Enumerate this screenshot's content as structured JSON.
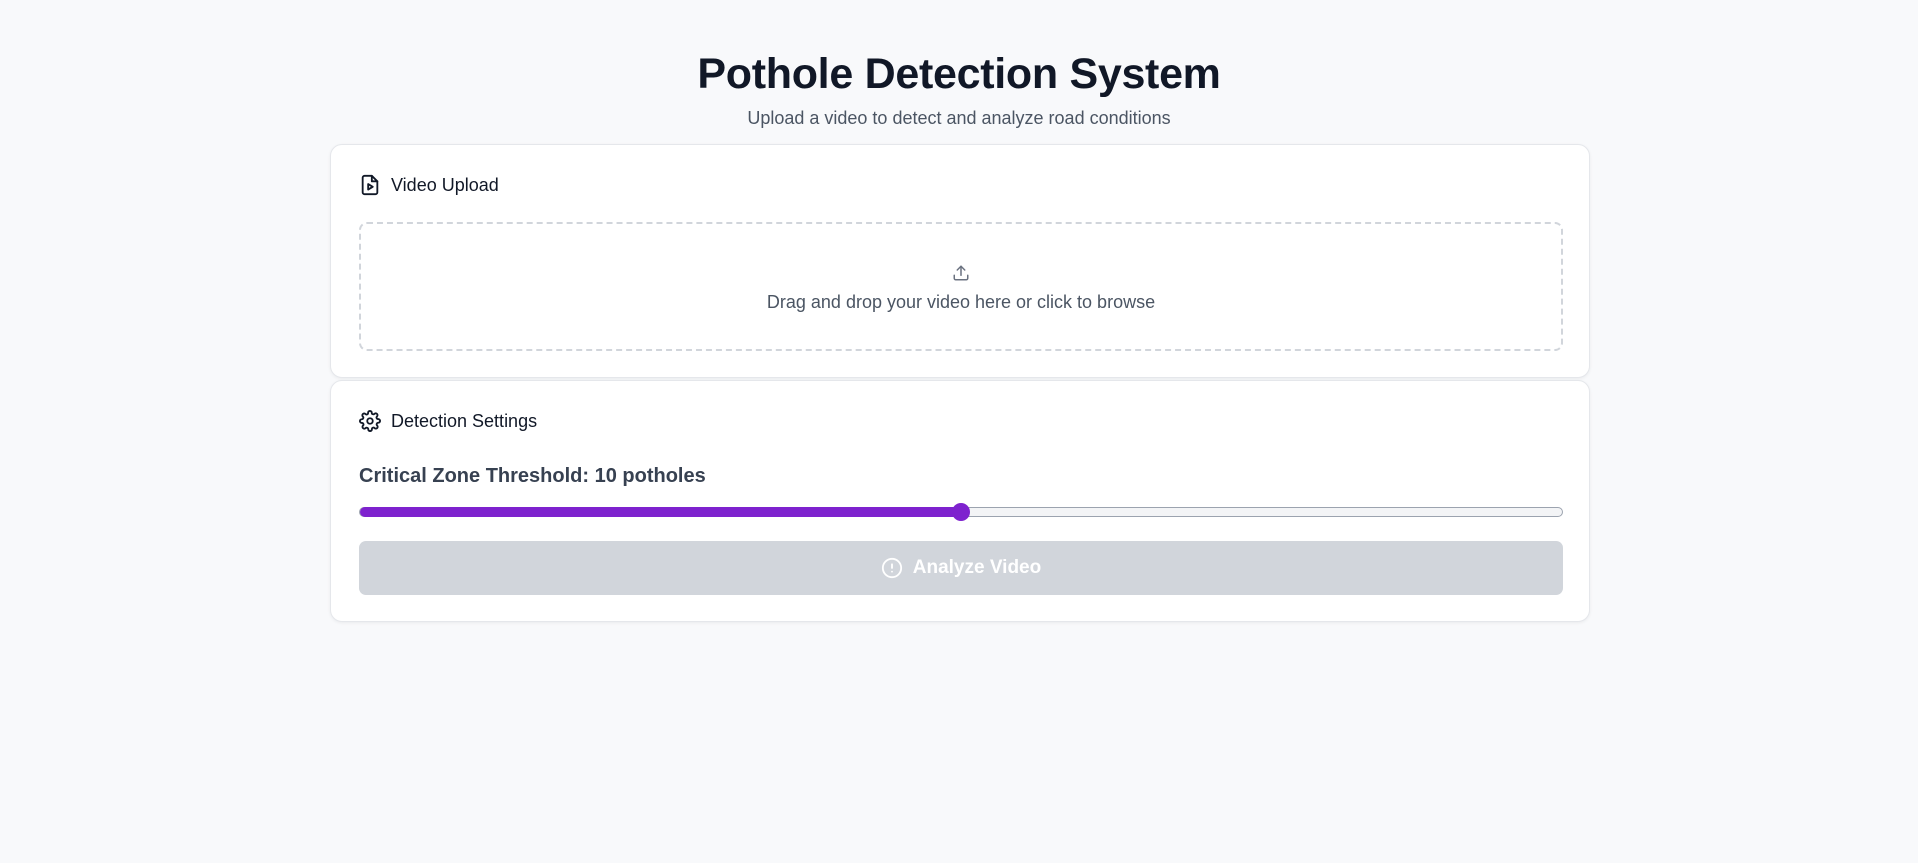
{
  "header": {
    "title": "Pothole Detection System",
    "subtitle": "Upload a video to detect and analyze road conditions"
  },
  "upload": {
    "heading": "Video Upload",
    "heading_icon": "file-video-icon",
    "dropzone_icon": "upload-icon",
    "dropzone_text": "Drag and drop your video here or click to browse"
  },
  "settings": {
    "heading": "Detection Settings",
    "heading_icon": "gear-icon",
    "threshold_label": "Critical Zone Threshold: 10 potholes",
    "slider": {
      "value": 10,
      "min": 0,
      "max": 20,
      "fill_color": "#7e22ce"
    },
    "analyze_button": {
      "label": "Analyze Video",
      "icon": "alert-circle-icon",
      "disabled": true
    }
  }
}
